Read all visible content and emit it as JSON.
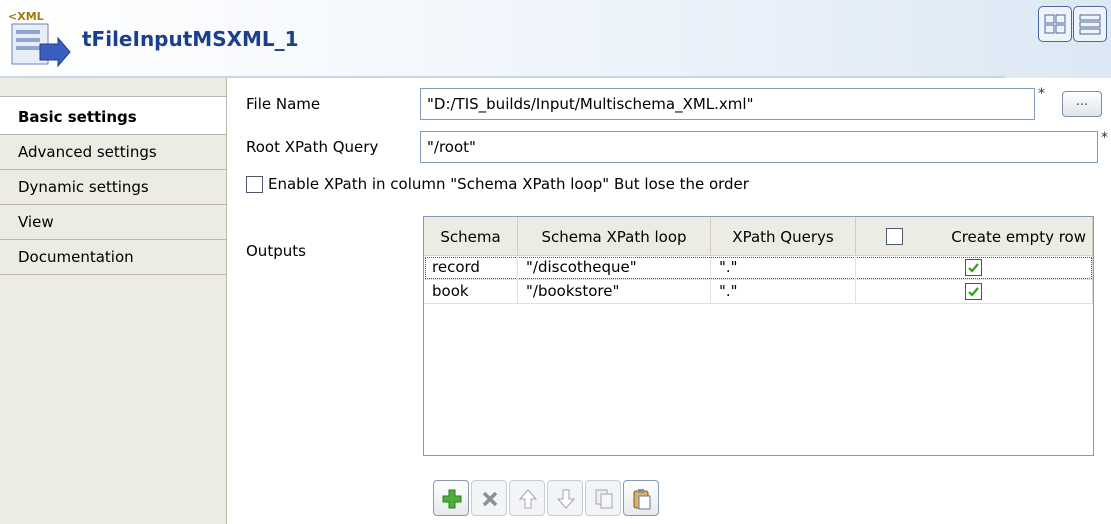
{
  "header": {
    "title": "tFileInputMSXML_1",
    "icon_text": "<XML",
    "icon": "xml-input-component-icon",
    "view_buttons": [
      {
        "name": "grid-view-button",
        "icon": "grid-view-icon"
      },
      {
        "name": "list-view-button",
        "icon": "list-view-icon"
      }
    ]
  },
  "sidebar": {
    "items": [
      {
        "label": "Basic settings",
        "active": true
      },
      {
        "label": "Advanced settings",
        "active": false
      },
      {
        "label": "Dynamic settings",
        "active": false
      },
      {
        "label": "View",
        "active": false
      },
      {
        "label": "Documentation",
        "active": false
      }
    ]
  },
  "form": {
    "file_name": {
      "label": "File Name",
      "value": "\"D:/TIS_builds/Input/Multischema_XML.xml\"",
      "required_mark": "*",
      "browse_label": "..."
    },
    "root_xpath": {
      "label": "Root XPath Query",
      "value": "\"/root\"",
      "required_mark": "*"
    },
    "enable_xpath": {
      "label": "Enable XPath in column \"Schema XPath loop\" But lose the order",
      "checked": false
    },
    "outputs_label": "Outputs"
  },
  "outputs_table": {
    "columns": [
      "Schema",
      "Schema XPath loop",
      "XPath Querys",
      "Create empty row"
    ],
    "header_checkbox_checked": false,
    "rows": [
      {
        "schema": "record",
        "loop": "\"/discotheque\"",
        "query": "\".\"",
        "create_empty_row": true
      },
      {
        "schema": "book",
        "loop": "\"/bookstore\"",
        "query": "\".\"",
        "create_empty_row": true
      }
    ]
  },
  "toolbar": {
    "buttons": [
      {
        "name": "add-row-button",
        "icon": "plus-icon",
        "enabled": true
      },
      {
        "name": "remove-row-button",
        "icon": "delete-icon",
        "enabled": false
      },
      {
        "name": "move-up-button",
        "icon": "arrow-up-icon",
        "enabled": false
      },
      {
        "name": "move-down-button",
        "icon": "arrow-down-icon",
        "enabled": false
      },
      {
        "name": "copy-button",
        "icon": "copy-icon",
        "enabled": false
      },
      {
        "name": "paste-button",
        "icon": "paste-icon",
        "enabled": true
      }
    ]
  },
  "colors": {
    "title": "#1b3f8a",
    "accent_green": "#3c9a2c",
    "sidebar_bg": "#ecebe4"
  }
}
